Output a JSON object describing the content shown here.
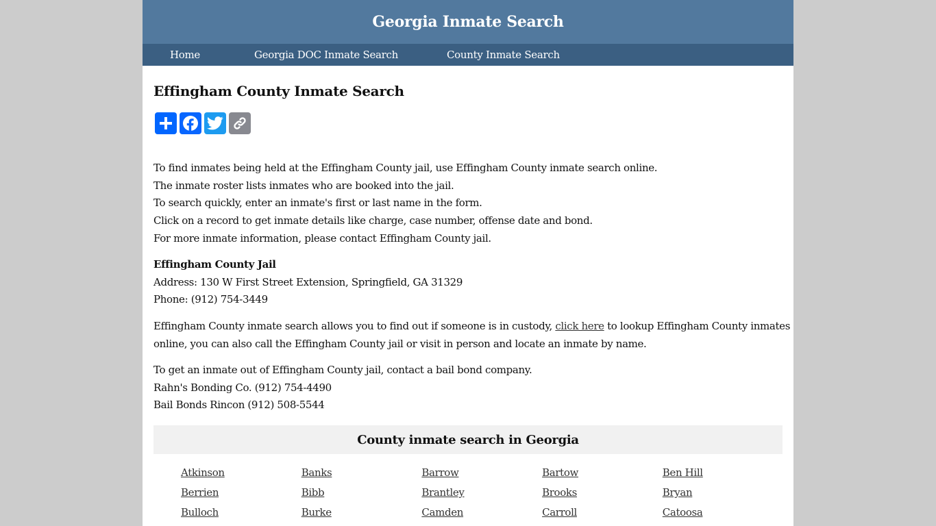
{
  "header": {
    "site_title": "Georgia Inmate Search"
  },
  "nav": {
    "items": [
      {
        "label": "Home"
      },
      {
        "label": "Georgia DOC Inmate Search"
      },
      {
        "label": "County Inmate Search"
      }
    ]
  },
  "main": {
    "title": "Effingham County Inmate Search",
    "share_buttons": [
      {
        "icon": "plus-icon",
        "label": "Share"
      },
      {
        "icon": "facebook-icon",
        "label": "Facebook"
      },
      {
        "icon": "twitter-icon",
        "label": "Twitter"
      },
      {
        "icon": "link-icon",
        "label": "Copy Link"
      }
    ],
    "intro_lines": [
      "To find inmates being held at the Effingham County jail, use Effingham County inmate search online.",
      "The inmate roster lists inmates who are booked into the jail.",
      "To search quickly, enter an inmate's first or last name in the form.",
      "Click on a record to get inmate details like charge, case number, offense date and bond.",
      "For more inmate information, please contact Effingham County jail."
    ],
    "jail": {
      "name": "Effingham County Jail",
      "address": "Address: 130 W First Street Extension, Springfield, GA 31329",
      "phone": "Phone: (912) 754-3449"
    },
    "lookup": {
      "before_link": "Effingham County inmate search allows you to find out if someone is in custody, ",
      "link_text": "click here",
      "after_link_line1": " to lookup Effingham County inmates",
      "line2": "online, you can also call the Effingham County jail or visit in person and locate an inmate by name."
    },
    "bail": {
      "intro": "To get an inmate out of Effingham County jail, contact a bail bond company.",
      "companies": [
        "Rahn's Bonding Co. (912) 754-4490",
        "Bail Bonds Rincon (912) 508-5544"
      ]
    }
  },
  "counties": {
    "heading": "County inmate search in Georgia",
    "items": [
      "Atkinson",
      "Banks",
      "Barrow",
      "Bartow",
      "Ben Hill",
      "Berrien",
      "Bibb",
      "Brantley",
      "Brooks",
      "Bryan",
      "Bulloch",
      "Burke",
      "Camden",
      "Carroll",
      "Catoosa"
    ]
  },
  "colors": {
    "header_bg": "#52799e",
    "nav_bg": "#3b5f82",
    "page_bg": "#cccccc",
    "counties_head_bg": "#f1f1f1"
  }
}
